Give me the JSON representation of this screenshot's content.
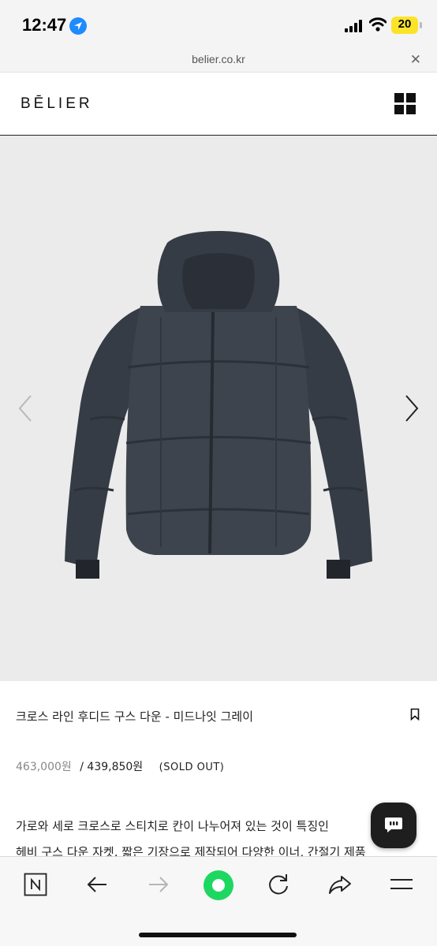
{
  "status_bar": {
    "time": "12:47",
    "battery": "20",
    "icons": [
      "location-arrow-icon",
      "signal-icon",
      "wifi-icon",
      "battery-icon"
    ]
  },
  "browser": {
    "url": "belier.co.kr",
    "close_glyph": "✕"
  },
  "site": {
    "brand": "BĒLIER",
    "menu_icon": "grid-menu-icon"
  },
  "product": {
    "image_alt_icon": "puffer-jacket-image",
    "title": "크로스 라인 후디드 구스 다운 - 미드나잇 그레이",
    "price_original": "463,000원",
    "price_separator": "/",
    "price_sale": "439,850원",
    "status": "(SOLD OUT)",
    "description_line1": "가로와 세로 크로스로 스티치로 칸이 나누어져 있는 것이 특징인",
    "description_line2": "헤비 구스 다운 자켓. 짧은 기장으로 제작되어 다양한 이너, 간절기 제품"
  },
  "toolbar": {
    "items": [
      "naver-n-icon",
      "back-arrow-icon",
      "forward-arrow-icon",
      "green-dot-icon",
      "reload-icon",
      "share-icon",
      "menu-lines-icon"
    ]
  },
  "colors": {
    "accent_green": "#1ed760",
    "location_blue": "#1e8bff",
    "battery_yellow": "#fbe32c",
    "gallery_bg": "#ebebeb"
  }
}
